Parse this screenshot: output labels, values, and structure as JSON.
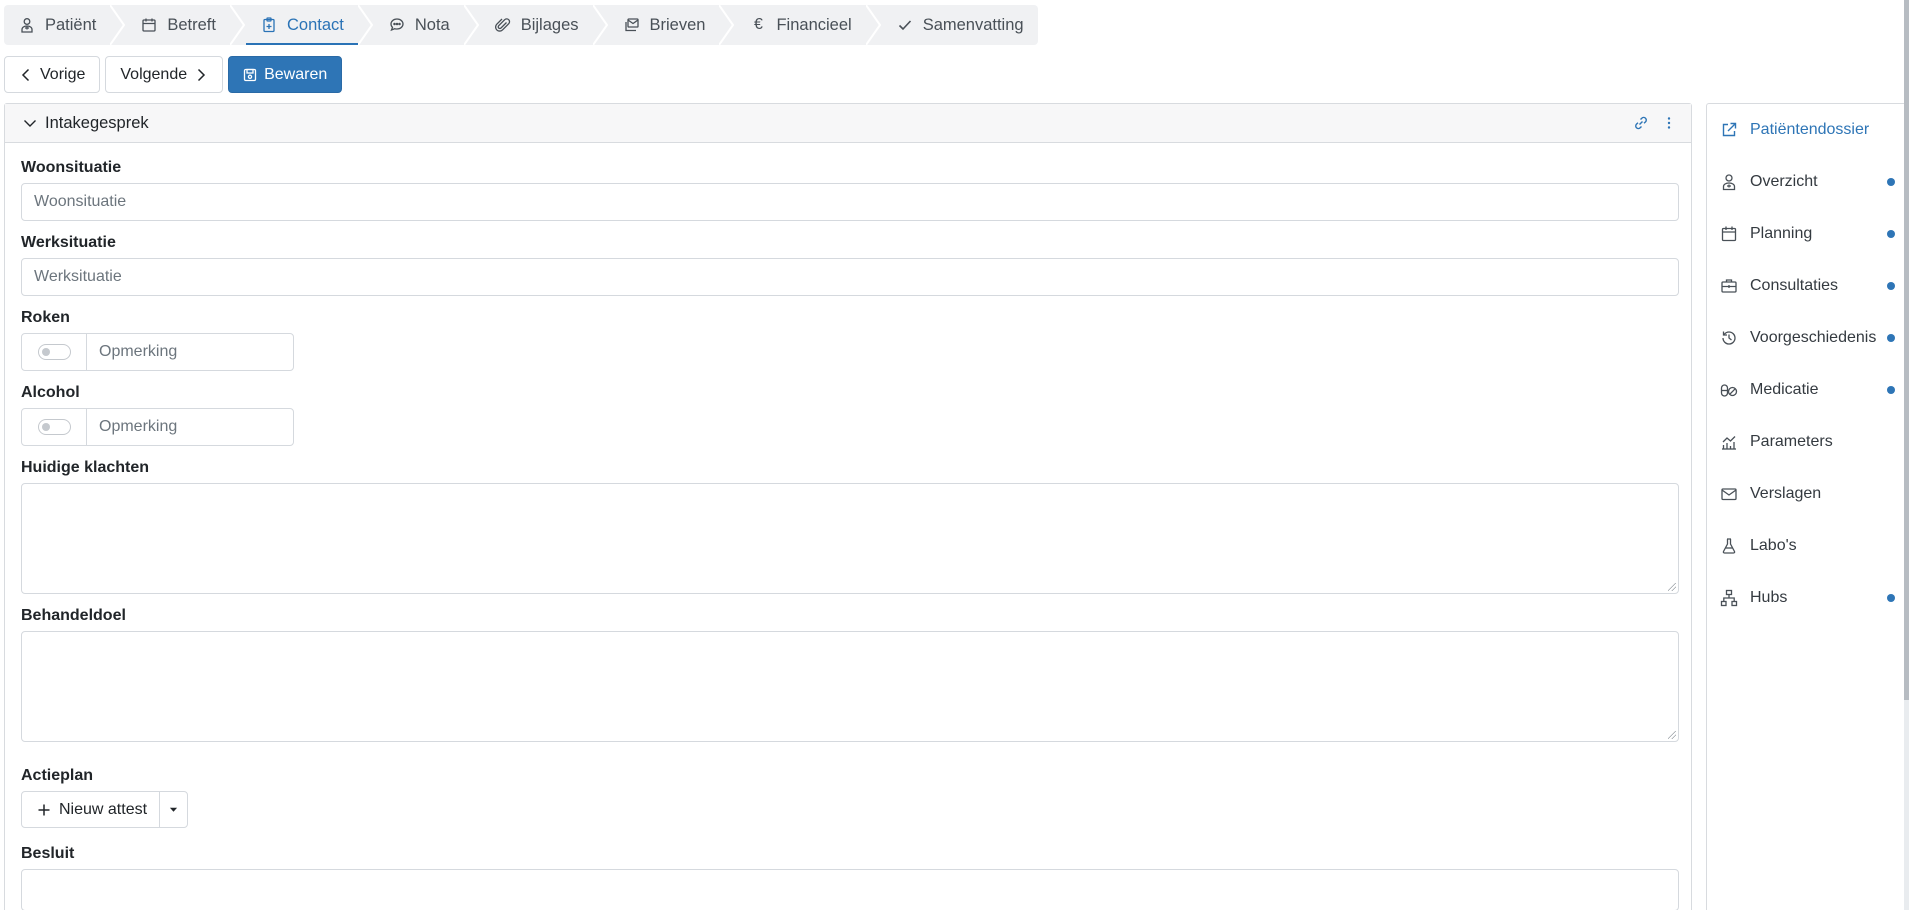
{
  "wizard": {
    "steps": [
      {
        "label": "Patiënt",
        "icon": "patient-icon"
      },
      {
        "label": "Betreft",
        "icon": "calendar-icon"
      },
      {
        "label": "Contact",
        "icon": "clipboard-plus-icon",
        "active": true
      },
      {
        "label": "Nota",
        "icon": "chat-bubble-icon"
      },
      {
        "label": "Bijlages",
        "icon": "paperclip-icon"
      },
      {
        "label": "Brieven",
        "icon": "envelopes-icon"
      },
      {
        "label": "Financieel",
        "icon": "euro-icon"
      },
      {
        "label": "Samenvatting",
        "icon": "check-icon"
      }
    ]
  },
  "toolbar": {
    "prev_label": "Vorige",
    "next_label": "Volgende",
    "save_label": "Bewaren"
  },
  "panel": {
    "title": "Intakegesprek",
    "fields": {
      "woonsituatie": {
        "label": "Woonsituatie",
        "placeholder": "Woonsituatie"
      },
      "werksituatie": {
        "label": "Werksituatie",
        "placeholder": "Werksituatie"
      },
      "roken": {
        "label": "Roken",
        "placeholder": "Opmerking",
        "toggle_on": false
      },
      "alcohol": {
        "label": "Alcohol",
        "placeholder": "Opmerking",
        "toggle_on": false
      },
      "klachten": {
        "label": "Huidige klachten"
      },
      "behandeldoel": {
        "label": "Behandeldoel"
      },
      "actieplan": {
        "label": "Actieplan",
        "button_label": "Nieuw attest"
      },
      "besluit": {
        "label": "Besluit"
      }
    }
  },
  "sidebar": {
    "items": [
      {
        "label": "Patiëntendossier",
        "icon": "external-link-icon",
        "dot": false
      },
      {
        "label": "Overzicht",
        "icon": "person-icon",
        "dot": true
      },
      {
        "label": "Planning",
        "icon": "calendar-icon",
        "dot": true
      },
      {
        "label": "Consultaties",
        "icon": "briefcase-medical-icon",
        "dot": true
      },
      {
        "label": "Voorgeschiedenis",
        "icon": "history-icon",
        "dot": true
      },
      {
        "label": "Medicatie",
        "icon": "pills-icon",
        "dot": true
      },
      {
        "label": "Parameters",
        "icon": "chart-bars-icon",
        "dot": false
      },
      {
        "label": "Verslagen",
        "icon": "envelope-icon",
        "dot": false
      },
      {
        "label": "Labo's",
        "icon": "flask-icon",
        "dot": false
      },
      {
        "label": "Hubs",
        "icon": "network-icon",
        "dot": true
      }
    ]
  },
  "colors": {
    "accent": "#2e75b6",
    "tab_bg": "#f0f1f3",
    "border": "#d5d9de"
  }
}
